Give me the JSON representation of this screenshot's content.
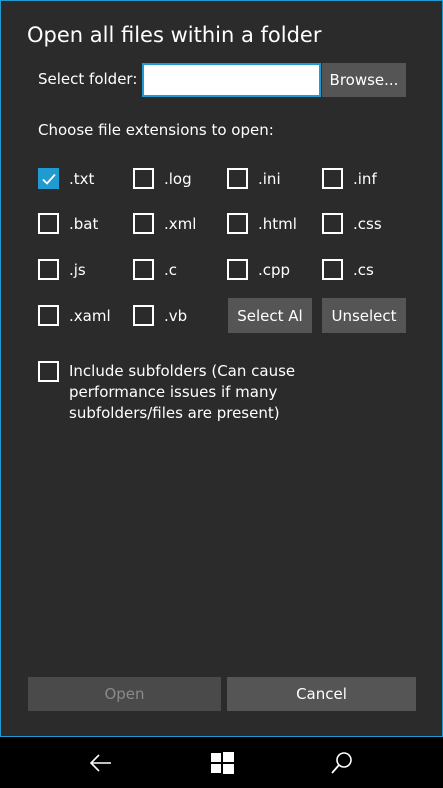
{
  "dialog": {
    "title": "Open all files within a folder",
    "folder_label": "Select folder:",
    "folder_value": "",
    "browse_label": "Browse...",
    "choose_label": "Choose file extensions to open:",
    "extensions": [
      {
        "label": ".txt",
        "checked": true
      },
      {
        "label": ".log",
        "checked": false
      },
      {
        "label": ".ini",
        "checked": false
      },
      {
        "label": ".inf",
        "checked": false
      },
      {
        "label": ".bat",
        "checked": false
      },
      {
        "label": ".xml",
        "checked": false
      },
      {
        "label": ".html",
        "checked": false
      },
      {
        "label": ".css",
        "checked": false
      },
      {
        "label": ".js",
        "checked": false
      },
      {
        "label": ".c",
        "checked": false
      },
      {
        "label": ".cpp",
        "checked": false
      },
      {
        "label": ".cs",
        "checked": false
      },
      {
        "label": ".xaml",
        "checked": false
      },
      {
        "label": ".vb",
        "checked": false
      }
    ],
    "select_all_label": "Select Al",
    "unselect_label": "Unselect",
    "subfolders_label": "Include subfolders (Can cause performance issues if many subfolders/files are present)",
    "subfolders_checked": false,
    "open_label": "Open",
    "cancel_label": "Cancel"
  },
  "colors": {
    "accent": "#1f9bd1",
    "background": "#2b2b2b",
    "button": "#555555"
  },
  "navbar": {
    "icons": [
      "back-arrow-icon",
      "windows-start-icon",
      "search-icon"
    ]
  }
}
